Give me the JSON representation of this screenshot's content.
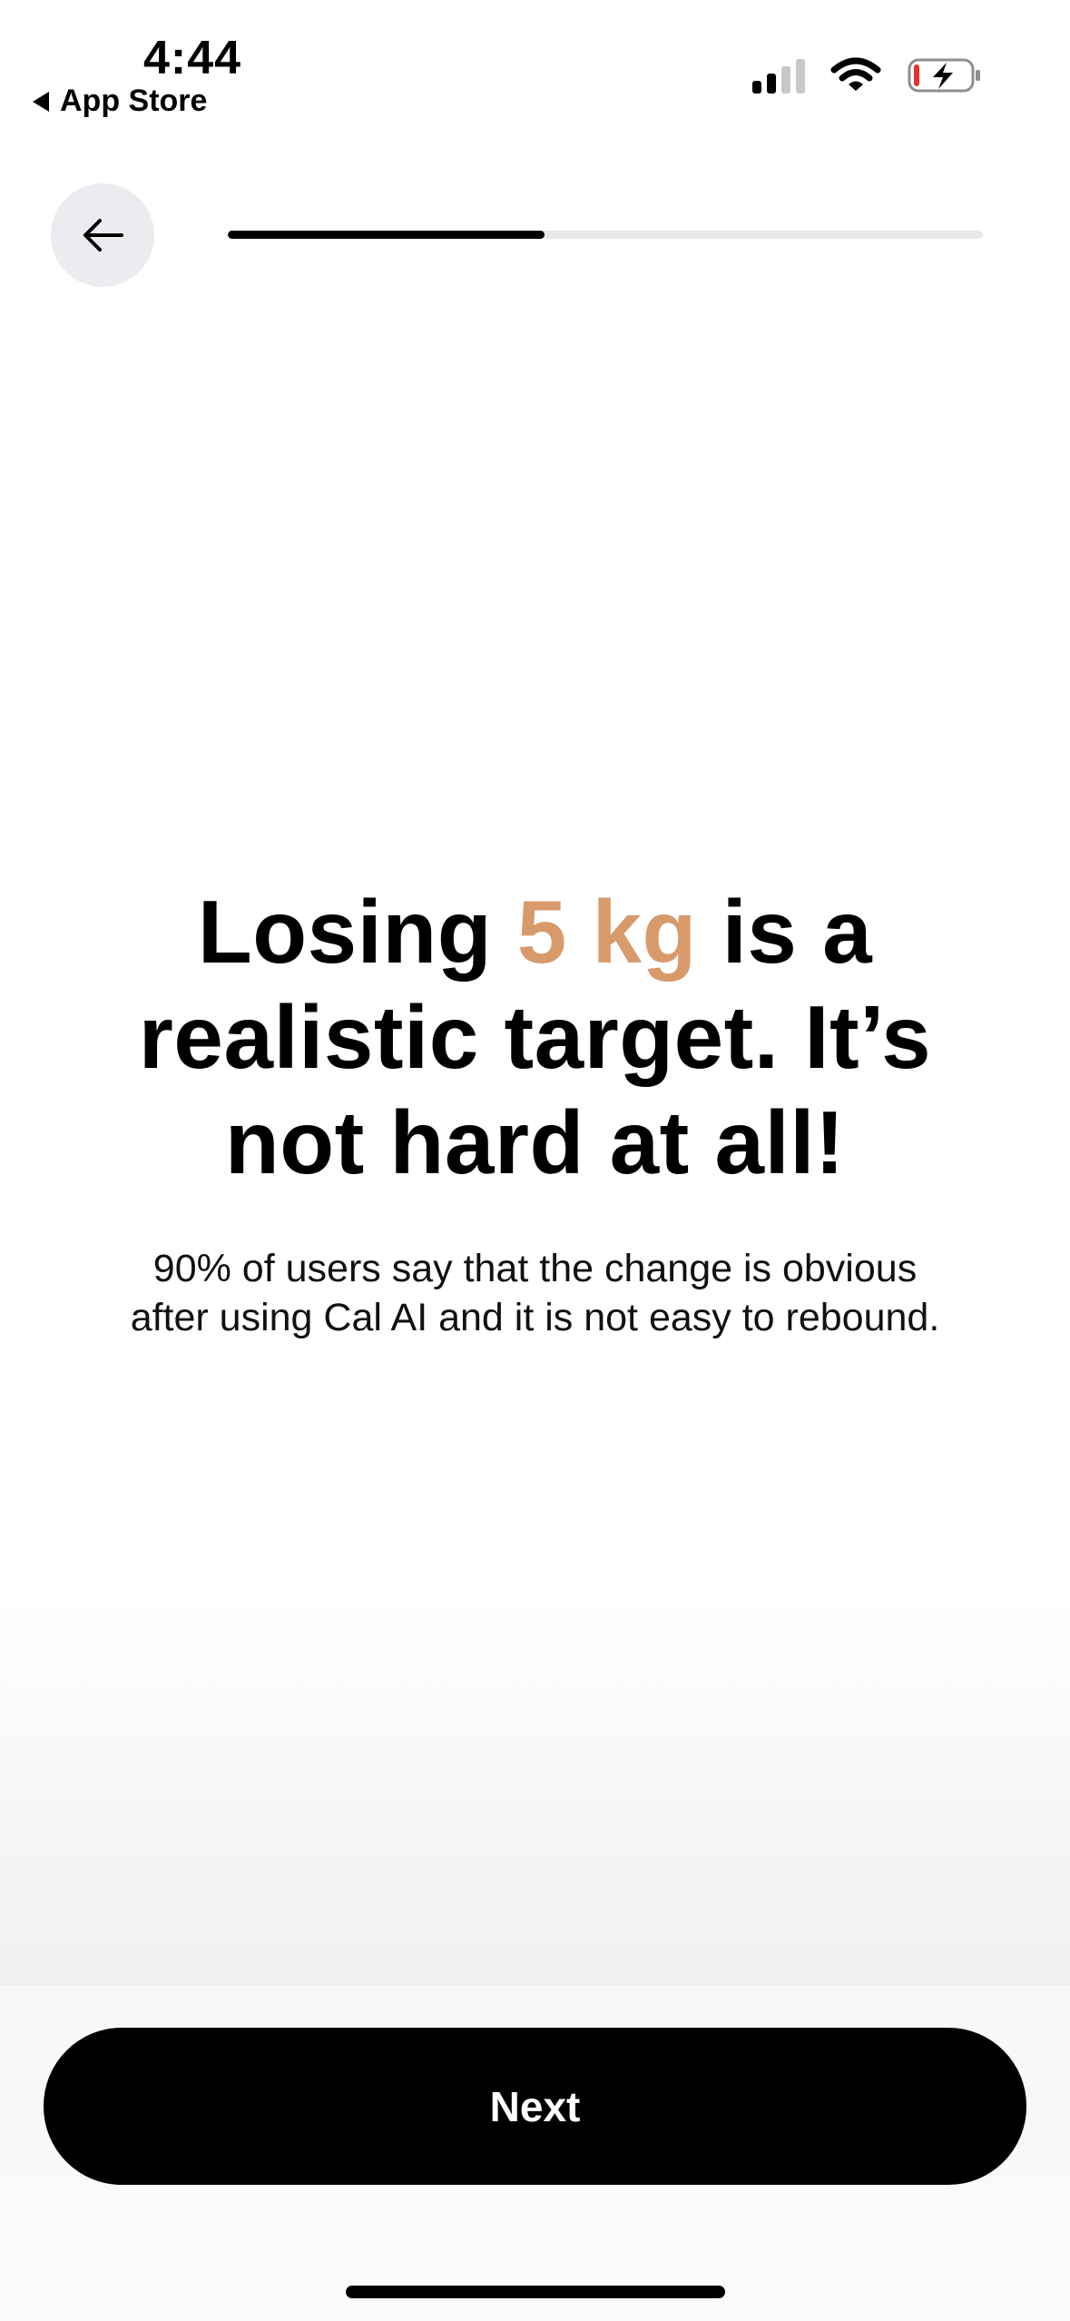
{
  "status_bar": {
    "time": "4:44",
    "back_label": "App Store",
    "battery_color": "#e5322d"
  },
  "nav": {
    "back_icon": "arrow-left-icon",
    "progress_fraction": 0.42
  },
  "main": {
    "headline_prefix": "Losing ",
    "headline_highlight": "5 kg",
    "headline_suffix": " is a realistic target. It’s not hard at all!",
    "highlight_color": "#d89a6b",
    "subtext": "90% of users say that the change is obvious after using Cal AI and it is not easy to rebound."
  },
  "footer": {
    "next_label": "Next"
  }
}
